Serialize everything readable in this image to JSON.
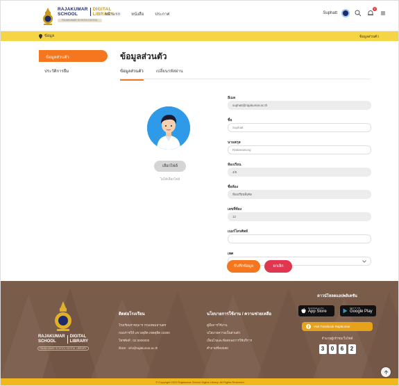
{
  "header": {
    "logo": {
      "line1_left": "RAJAKUMAR",
      "line2_left": "SCHOOL",
      "line1_right": "DIGITAL",
      "line2_right": "LIBRARY",
      "sub": "RAJAKUMAR SCHOOL DIGITAL LIBRARY"
    },
    "nav": [
      "หน้าแรก",
      "หนังสือ",
      "ประกาศ"
    ],
    "user_name": "Suphatt",
    "notification_count": "0"
  },
  "location_bar": {
    "location": "ข้อมูล",
    "right": "ข้อมูลส่วนตัว"
  },
  "sidebar": {
    "active_item": "ข้อมูลส่วนตัว",
    "items": [
      "ประวัติการยืม"
    ]
  },
  "main": {
    "title": "ข้อมูลส่วนตัว",
    "tabs": [
      "ข้อมูลส่วนตัว",
      "เปลี่ยนรหัสผ่าน"
    ],
    "upload_button": "เลือกไฟล์",
    "upload_note": "ไม่ได้เลือกไฟล์",
    "fields": [
      {
        "label": "อีเมล",
        "value": "suphatt@rajakumar.ac.th",
        "readonly": true
      },
      {
        "label": "ชื่อ",
        "value": "Suphatt",
        "readonly": false
      },
      {
        "label": "นามสกุล",
        "value": "Rattanawong",
        "readonly": false
      },
      {
        "label": "ห้องเรียน",
        "value": "4/5",
        "readonly": true
      },
      {
        "label": "ชื่อห้อง",
        "value": "ห้องเรียนพิเศษ",
        "readonly": true
      },
      {
        "label": "เลขที่ห้อง",
        "value": "12",
        "readonly": true
      },
      {
        "label": "เบอร์โทรศัพท์",
        "value": "",
        "readonly": false
      }
    ],
    "select_label": "เพศ",
    "select_value": "ชาย",
    "save_button": "บันทึกข้อมูล",
    "cancel_button": "ยกเลิก"
  },
  "footer": {
    "logo": {
      "left1": "RAJAKUMAR",
      "left2": "SCHOOL",
      "right1": "DIGITAL",
      "right2": "LIBRARY",
      "sub": "RAJAKUMAR SCHOOL DIGITAL LIBRARY"
    },
    "contact": {
      "heading": "ติดต่อโรงเรียน",
      "lines": [
        "โรงเรียนราชกุมาร กรุงเทพมหานคร",
        "ถนนราชวิถี แขวงดุสิต เขตดุสิต 10300",
        "โทรศัพท์ : 02 0000000",
        "อีเมล : info@rajakumar.ac.th"
      ]
    },
    "links": {
      "heading": "นโยบายการใช้งาน / ความช่วยเหลือ",
      "lines": [
        "คู่มือการใช้งาน",
        "นโยบายความเป็นส่วนตัว",
        "เงื่อนไขและข้อตกลงการใช้บริการ",
        "คำถามที่พบบ่อย"
      ]
    },
    "apps": {
      "heading": "ดาวน์โหลดแอปพลิเคชัน",
      "appstore_small": "Download on the",
      "appstore_big": "App Store",
      "googleplay_small": "GET IT ON",
      "googleplay_big": "Google Play",
      "facebook": "Visit Facebook Rajakumar",
      "visitors_label": "จำนวนผู้เข้าชมเว็บไซต์",
      "visitors": [
        "3",
        "0",
        "6",
        "2"
      ]
    },
    "copyright": "© Copyright 2023 Rajakumar School Digital Library. All Rights Reserved."
  },
  "colors": {
    "accent": "#f4761f",
    "danger": "#e0364f",
    "yellow_bar": "#f5d445",
    "footer_bg": "#7a5c4a",
    "navy": "#1d2a6b"
  }
}
